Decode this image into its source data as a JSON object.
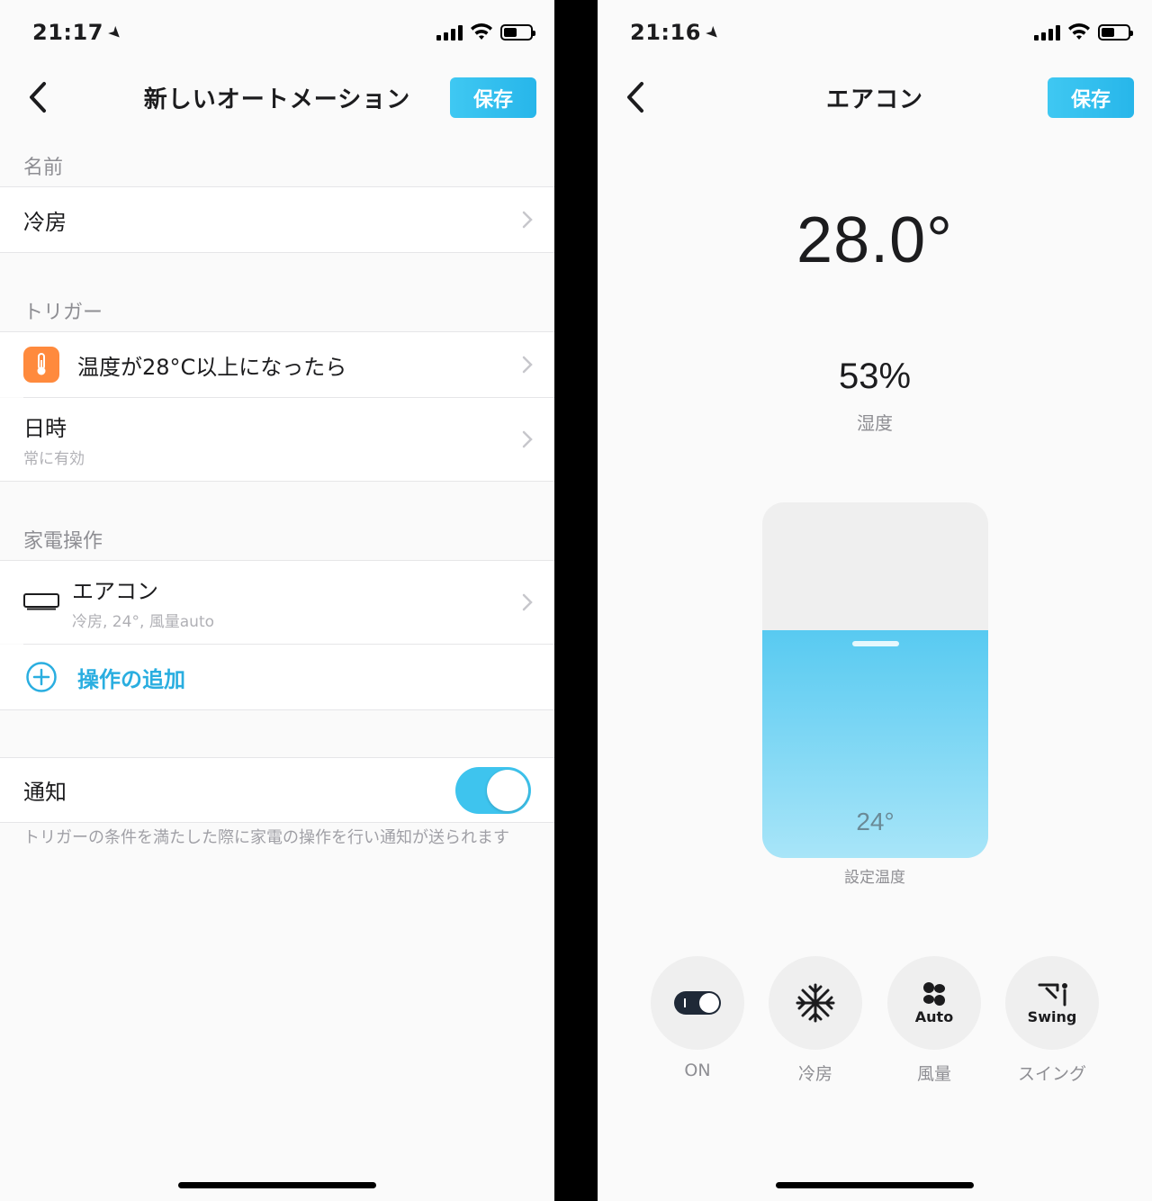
{
  "left": {
    "status": {
      "time": "21:17"
    },
    "nav": {
      "title": "新しいオートメーション",
      "save_label": "保存"
    },
    "name_section": {
      "header": "名前",
      "value": "冷房"
    },
    "trigger_section": {
      "header": "トリガー",
      "condition": "温度が28°C以上になったら",
      "datetime_label": "日時",
      "datetime_sub": "常に有効"
    },
    "appliance_section": {
      "header": "家電操作",
      "device_name": "エアコン",
      "device_detail": "冷房, 24°, 風量auto",
      "add_label": "操作の追加"
    },
    "notification": {
      "label": "通知",
      "enabled": true,
      "note": "トリガーの条件を満たした際に家電の操作を行い通知が送られます"
    }
  },
  "right": {
    "status": {
      "time": "21:16"
    },
    "nav": {
      "title": "エアコン",
      "save_label": "保存"
    },
    "room_temp": "28.0°",
    "humidity": "53%",
    "humidity_label": "湿度",
    "set_temp": "24°",
    "set_temp_label": "設定温度",
    "set_temp_fill_fraction": 0.64,
    "modes": [
      {
        "icon": "power-toggle-icon",
        "caption": "ON"
      },
      {
        "icon": "snowflake-icon",
        "caption": "冷房"
      },
      {
        "icon": "fan-icon",
        "inner": "Auto",
        "caption": "風量"
      },
      {
        "icon": "swing-icon",
        "inner": "Swing",
        "caption": "スイング"
      }
    ]
  },
  "colors": {
    "accent": "#2aaee0",
    "save_button": "#3fc8f2",
    "temp_icon_bg": "#ff8a3d",
    "slider_fill": "#58caf1",
    "toggle_on": "#3ec4ee"
  }
}
